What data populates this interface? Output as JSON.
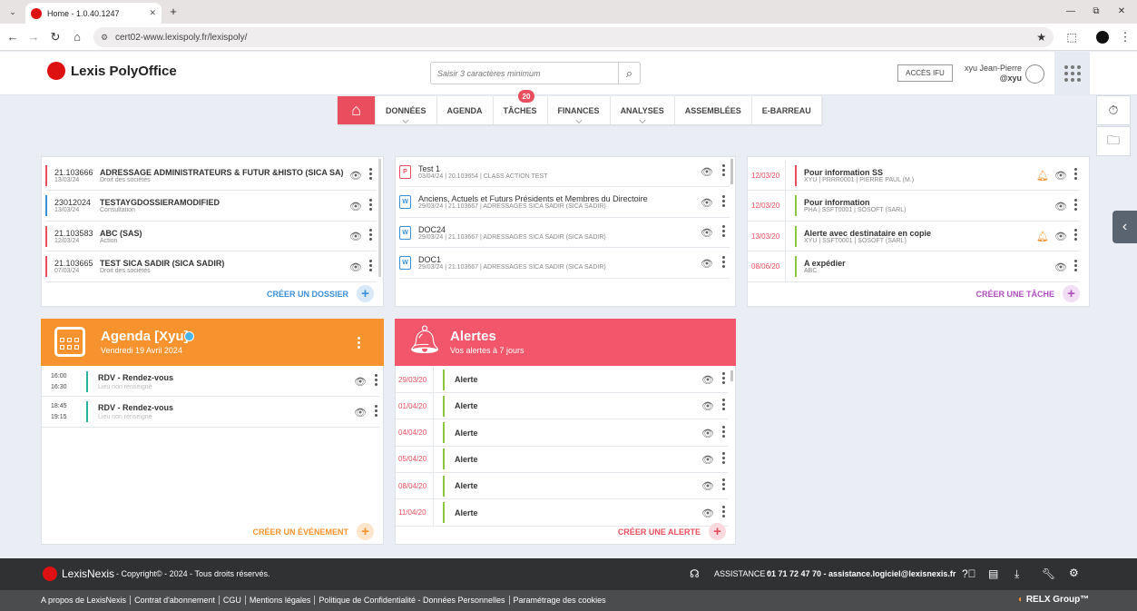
{
  "browser": {
    "tab_title": "Home - 1.0.40.1247",
    "new_tab": "+",
    "url": "cert02-www.lexispoly.fr/lexispoly/",
    "window_min": "—",
    "window_max": "⧉",
    "window_close": "✕"
  },
  "header": {
    "logo": "Lexis PolyOffice",
    "search_placeholder": "Saisir 3 caractères minimum",
    "acces_ifu": "ACCÈS IFU",
    "user_name": "xyu Jean-Pierre",
    "user_handle": "@xyu"
  },
  "menu": {
    "items": [
      "DONNÉES",
      "AGENDA",
      "TÂCHES",
      "FINANCES",
      "ANALYSES",
      "ASSEMBLÉES",
      "E-BARREAU"
    ],
    "taches_badge": "20"
  },
  "dossiers": {
    "rows": [
      {
        "code": "21.103666",
        "date": "13/03/24",
        "title": "ADRESSAGE ADMINISTRATEURS & FUTUR &HISTO (SICA SA)",
        "sub": "Droit des sociétés",
        "color": "#e84e5e"
      },
      {
        "code": "23012024",
        "date": "13/03/24",
        "title": "TESTAYGDOSSIERAMODIFIED",
        "sub": "Consultation",
        "color": "#3a8fd9"
      },
      {
        "code": "21.103583",
        "date": "12/03/24",
        "title": "ABC (SAS)",
        "sub": "Action",
        "color": "#e84e5e"
      },
      {
        "code": "21.103665",
        "date": "07/03/24",
        "title": "TEST SICA SADIR (SICA SADIR)",
        "sub": "Droit des sociétés",
        "color": "#e84e5e"
      }
    ],
    "create_label": "CRÉER UN DOSSIER"
  },
  "documents": {
    "rows": [
      {
        "type": "pdf",
        "title": "Test 1",
        "meta": "03/04/24 | 20.103654 | CLASS ACTION TEST"
      },
      {
        "type": "word",
        "title": "Anciens, Actuels et Futurs Présidents et Membres du Directoire",
        "meta": "29/03/24 | 21.103667 | ADRESSAGES SICA SADIR (SICA SADIR)"
      },
      {
        "type": "word",
        "title": "DOC24",
        "meta": "29/03/24 | 21.103667 | ADRESSAGES SICA SADIR (SICA SADIR)"
      },
      {
        "type": "word",
        "title": "DOC1",
        "meta": "29/03/24 | 21.103667 | ADRESSAGES SICA SADIR (SICA SADIR)"
      }
    ]
  },
  "taches": {
    "rows": [
      {
        "date": "12/03/20",
        "title": "Pour information SS",
        "meta": "XYU | PRRR0001 | PIERRE PAUL (M.)",
        "bell": true,
        "color": "#e84e5e"
      },
      {
        "date": "12/03/20",
        "title": "Pour information",
        "meta": "PHA | SSFT0001 | SOSOFT (SARL)",
        "bell": false,
        "color": "#8cc63f"
      },
      {
        "date": "13/03/20",
        "title": "Alerte avec destinataire en copie",
        "meta": "XYU | SSFT0001 | SOSOFT (SARL)",
        "bell": true,
        "color": "#8cc63f"
      },
      {
        "date": "08/06/20",
        "title": "A expédier",
        "meta": "ABC",
        "bell": false,
        "color": "#8cc63f"
      }
    ],
    "create_label": "CRÉER UNE TÂCHE"
  },
  "agenda": {
    "title": "Agenda [Xyu]",
    "subtitle": "Vendredi 19 Avril 2024",
    "rows": [
      {
        "start": "16:00",
        "end": "16:30",
        "title": "RDV - Rendez-vous",
        "location": "Lieu non renseigné"
      },
      {
        "start": "18:45",
        "end": "19:15",
        "title": "RDV - Rendez-vous",
        "location": "Lieu non renseigné"
      }
    ],
    "create_label": "CRÉER UN ÉVÉNEMENT",
    "color": "#f7932f"
  },
  "alertes": {
    "title": "Alertes",
    "subtitle": "Vos alertes à 7 jours",
    "rows": [
      {
        "date": "29/03/20",
        "title": "Alerte"
      },
      {
        "date": "01/04/20",
        "title": "Alerte"
      },
      {
        "date": "04/04/20",
        "title": "Alerte"
      },
      {
        "date": "05/04/20",
        "title": "Alerte"
      },
      {
        "date": "08/04/20",
        "title": "Alerte"
      },
      {
        "date": "11/04/20",
        "title": "Alerte"
      }
    ],
    "create_label": "CRÉER UNE ALERTE",
    "color": "#f2566a"
  },
  "footer": {
    "brand": "LexisNexis",
    "copyright": "- Copyright© - 2024 - Tous droits réservés.",
    "assistance_label": "ASSISTANCE :",
    "assistance_contact": "01 71 72 47 70 - assistance.logiciel@lexisnexis.fr",
    "links": [
      "A propos de LexisNexis",
      "Contrat d'abonnement",
      "CGU",
      "Mentions légales",
      "Politique de Confidentialité - Données Personnelles",
      "Paramétrage des cookies"
    ],
    "relx": "RELX Group™"
  }
}
